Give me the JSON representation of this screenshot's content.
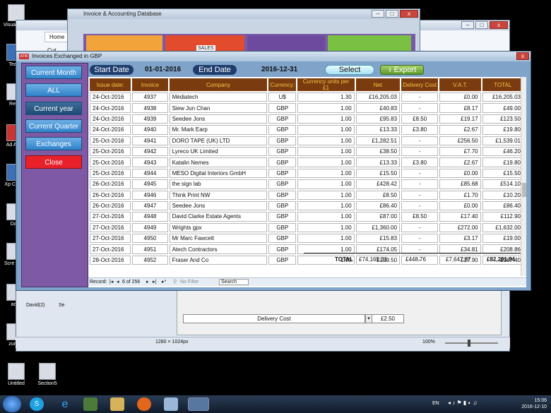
{
  "desktop_icons": [
    {
      "label": "Visual 2012"
    },
    {
      "label": "Team"
    },
    {
      "label": "Recy"
    },
    {
      "label": "Ad Acro"
    },
    {
      "label": "Xp Comp"
    },
    {
      "label": "Dav"
    },
    {
      "label": "Scre of m"
    },
    {
      "label": "acc"
    },
    {
      "label": "zurab"
    },
    {
      "label": "Untitled"
    },
    {
      "label": "Section5"
    }
  ],
  "bg_window_1": {
    "title": "Invoice & Accounting Database",
    "tile_text": "SALES"
  },
  "bg_window_2": {
    "tab_home": "Home",
    "cut": "Cut",
    "tab_david": "David(2)",
    "tab_se": "Se"
  },
  "lower_form": {
    "delivery_label": "Delivery Cost",
    "delivery_value": "£2.50"
  },
  "statusbar": {
    "size": "1280 × 1024px",
    "zoom": "100%"
  },
  "main_window": {
    "title": "Invoices Exchanged in GBP",
    "app_icon_text": "ATW",
    "close": "x"
  },
  "sidebar": {
    "current_month": "Current Month",
    "all": "ALL",
    "current_year": "Current year",
    "current_quarter": "Current Quarter",
    "exchanges": "Exchanges",
    "close": "Close"
  },
  "toolbar": {
    "start_date_label": "Start Date",
    "start_date_value": "01-01-2016",
    "end_date_label": "End Date",
    "end_date_value": "2016-12-31",
    "select": "Select",
    "export": "Export"
  },
  "table": {
    "columns": [
      "Issue date:",
      "Invoice",
      "Company",
      "Currency:",
      "Currency units per £1",
      "Net",
      "Delivery Cost",
      "V.A.T.",
      "TOTAL"
    ],
    "rows": [
      [
        "24-Oct-2016",
        "4937",
        "Médiatech",
        "U$",
        "1.30",
        "£16,205.03",
        "-",
        "£0.00",
        "£16,205.03"
      ],
      [
        "24-Oct-2016",
        "4938",
        "Siew Jun Chan",
        "GBP",
        "1.00",
        "£40.83",
        "-",
        "£8.17",
        "£49.00"
      ],
      [
        "24-Oct-2016",
        "4939",
        "Seedee Jons",
        "GBP",
        "1.00",
        "£95.83",
        "£8.50",
        "£19.17",
        "£123.50"
      ],
      [
        "24-Oct-2016",
        "4940",
        "Mr. Mark Earp",
        "GBP",
        "1.00",
        "£13.33",
        "£3.80",
        "£2.67",
        "£19.80"
      ],
      [
        "25-Oct-2016",
        "4941",
        "DORO TAPE (UK) LTD",
        "GBP",
        "1.00",
        "£1,282.51",
        "-",
        "£256.50",
        "£1,539.01"
      ],
      [
        "25-Oct-2016",
        "4942",
        "Lyreco UK Limited",
        "GBP",
        "1.00",
        "£38.50",
        "-",
        "£7.70",
        "£46.20"
      ],
      [
        "25-Oct-2016",
        "4943",
        "Katalin Nemes",
        "GBP",
        "1.00",
        "£13.33",
        "£3.80",
        "£2.67",
        "£19.80"
      ],
      [
        "25-Oct-2016",
        "4944",
        "MESO Digital Interiors GmbH",
        "GBP",
        "1.00",
        "£15.50",
        "-",
        "£0.00",
        "£15.50"
      ],
      [
        "26-Oct-2016",
        "4945",
        "the sign lab",
        "GBP",
        "1.00",
        "£428.42",
        "-",
        "£85.68",
        "£514.10"
      ],
      [
        "26-Oct-2016",
        "4946",
        "Think Print NW",
        "GBP",
        "1.00",
        "£8.50",
        "-",
        "£1.70",
        "£10.20"
      ],
      [
        "26-Oct-2016",
        "4947",
        "Seedee Jons",
        "GBP",
        "1.00",
        "£86.40",
        "-",
        "£0.00",
        "£86.40"
      ],
      [
        "27-Oct-2016",
        "4948",
        "David Clarke Estate Agents",
        "GBP",
        "1.00",
        "£87.00",
        "£8.50",
        "£17.40",
        "£112.90"
      ],
      [
        "27-Oct-2016",
        "4949",
        "Wrights gpx",
        "GBP",
        "1.00",
        "£1,360.00",
        "-",
        "£272.00",
        "£1,632.00"
      ],
      [
        "27-Oct-2016",
        "4950",
        "Mr Marc Fawcett",
        "GBP",
        "1.00",
        "£15.83",
        "-",
        "£3.17",
        "£19.00"
      ],
      [
        "27-Oct-2016",
        "4951",
        "Atech Contractors",
        "GBP",
        "1.00",
        "£174.05",
        "-",
        "£34.81",
        "£208.86"
      ],
      [
        "28-Oct-2016",
        "4952",
        "Fraser And Co",
        "GBP",
        "1.00",
        "£139.50",
        "-",
        "£27.90",
        "£167.40"
      ]
    ]
  },
  "totals": {
    "label": "TOTAL",
    "net": "£74,165.31",
    "delivery": "£448.76",
    "vat": "£7,647.87",
    "total": "£82,291.94"
  },
  "recordbar": {
    "label": "Record:",
    "position": "6 of 256",
    "no_filter": "No Filter",
    "search": "Search"
  },
  "taskbar": {
    "lang": "EN",
    "time": "15:06",
    "date": "2016-12-10"
  }
}
